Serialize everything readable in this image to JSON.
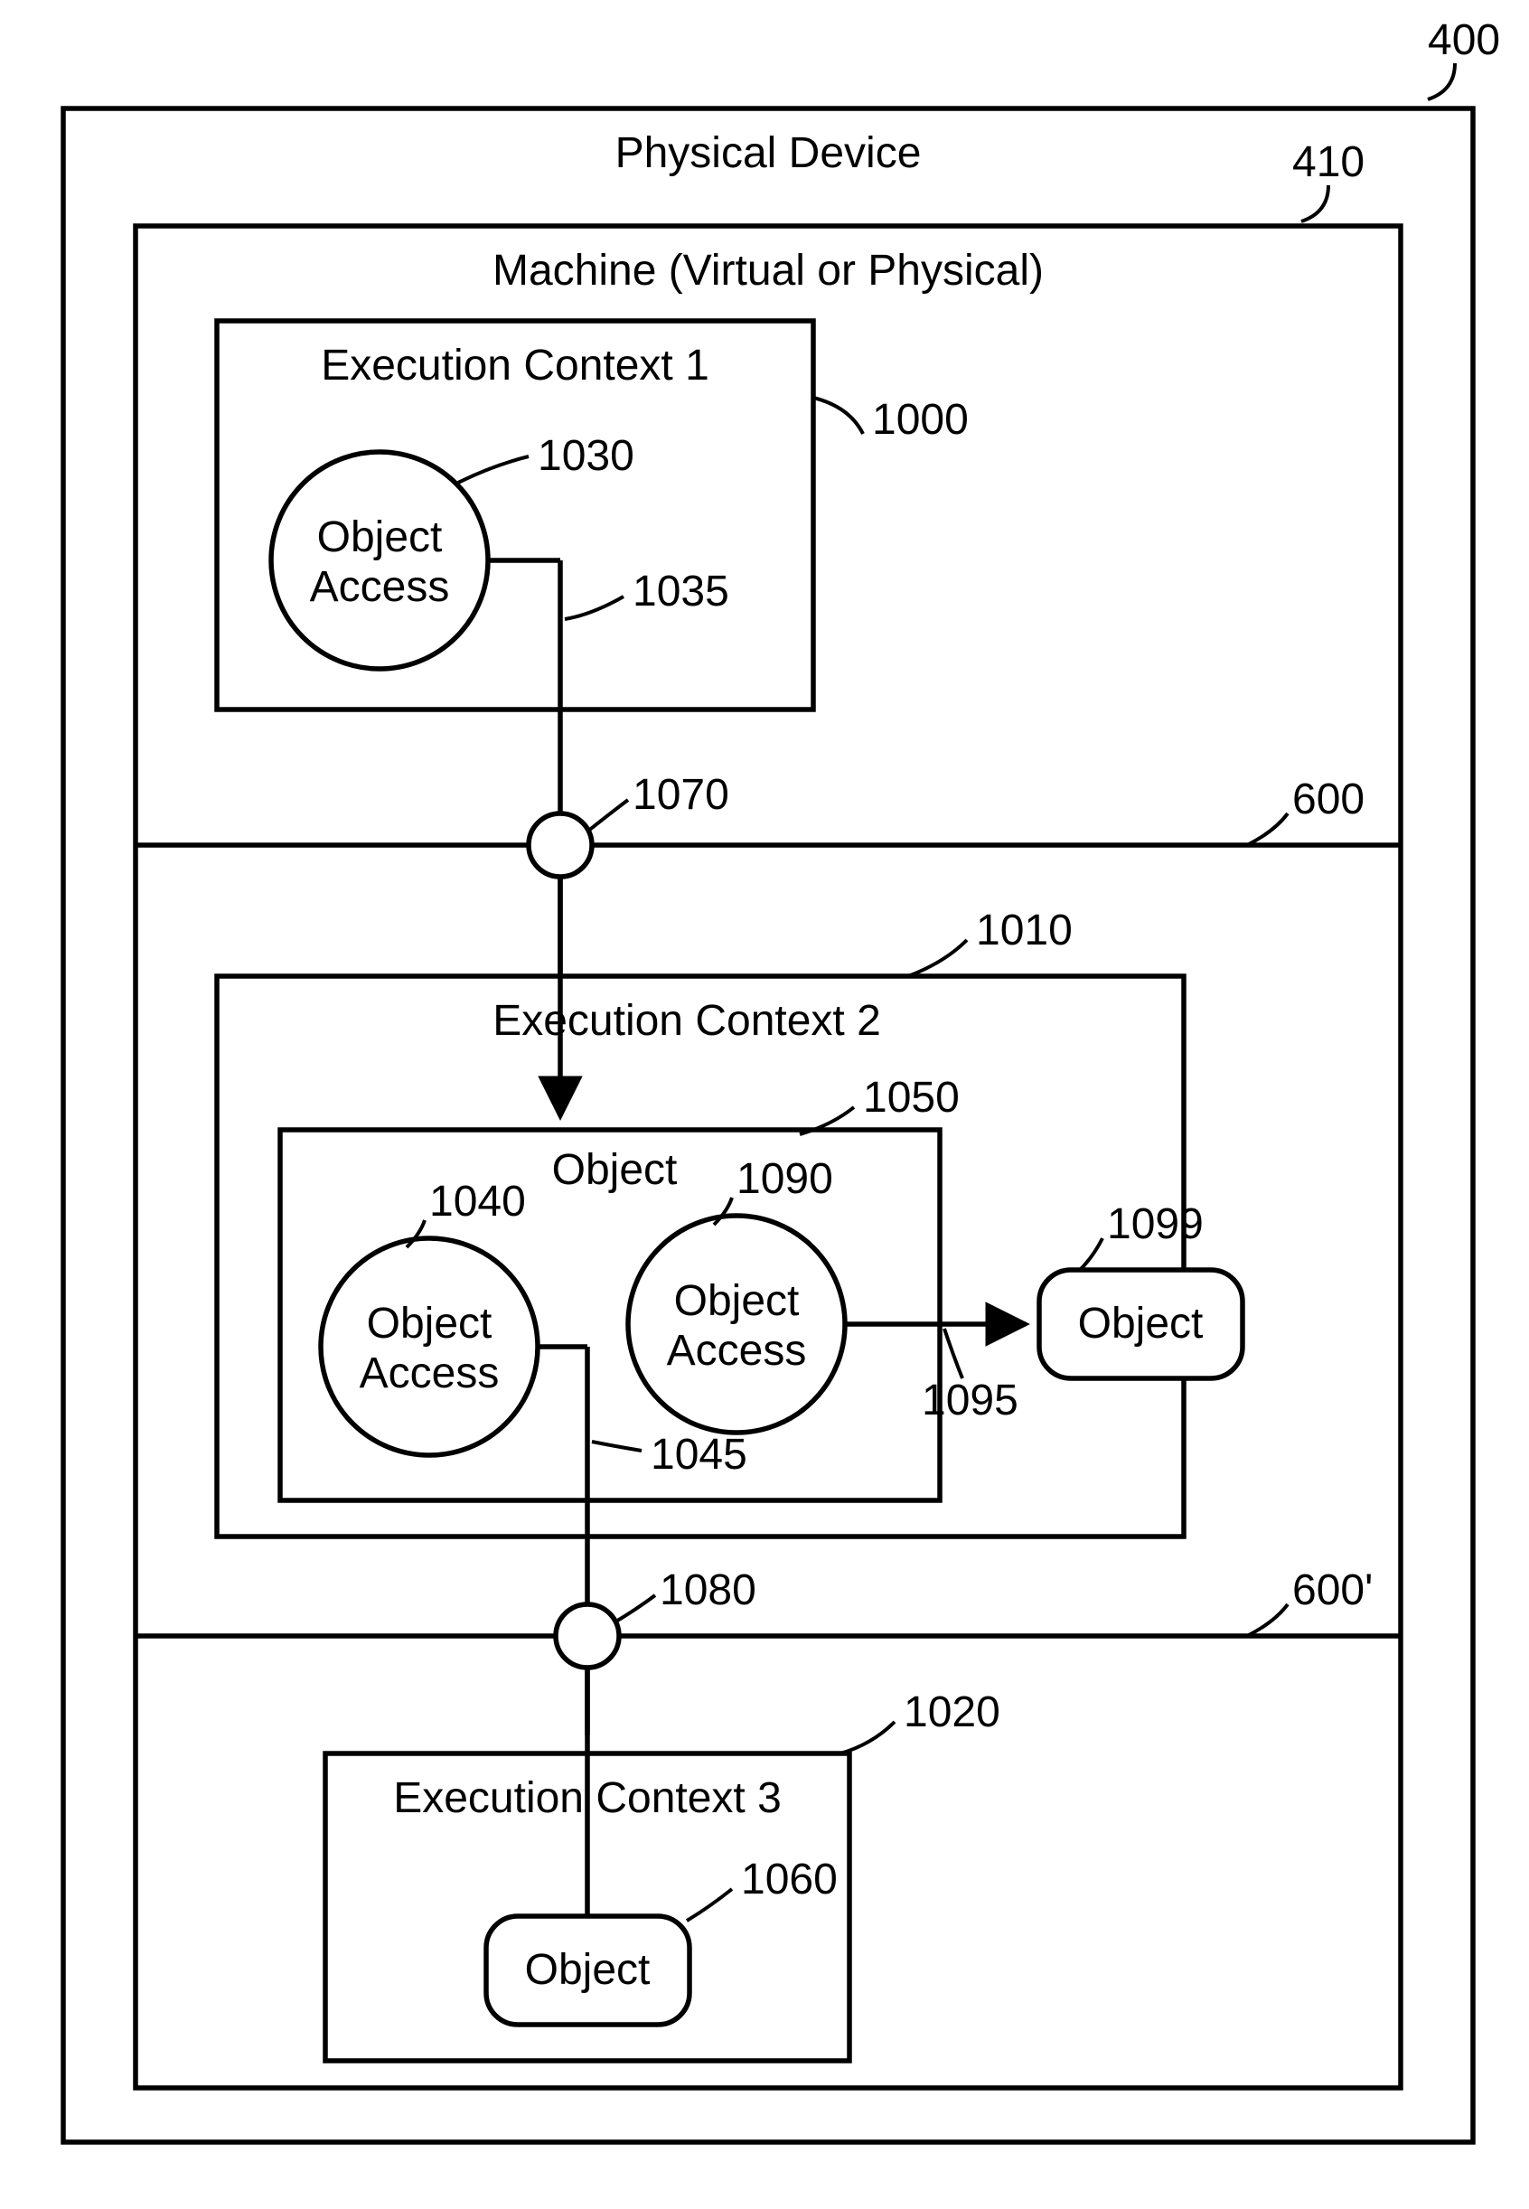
{
  "refs": {
    "r400": "400",
    "r410": "410",
    "r600": "600",
    "r600p": "600'",
    "r1000": "1000",
    "r1010": "1010",
    "r1020": "1020",
    "r1030": "1030",
    "r1035": "1035",
    "r1040": "1040",
    "r1045": "1045",
    "r1050": "1050",
    "r1060": "1060",
    "r1070": "1070",
    "r1080": "1080",
    "r1090": "1090",
    "r1095": "1095",
    "r1099": "1099"
  },
  "labels": {
    "physical_device": "Physical Device",
    "machine": "Machine (Virtual or Physical)",
    "ec1": "Execution Context 1",
    "ec2": "Execution Context 2",
    "ec3": "Execution Context 3",
    "object": "Object",
    "object_l1": "Object",
    "object_l2": "Access"
  }
}
